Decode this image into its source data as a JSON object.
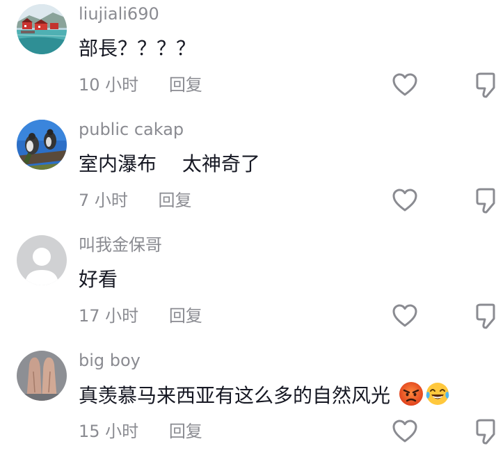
{
  "comments": [
    {
      "username": "liujiali690",
      "text": "部長？？？？",
      "time": "10 小时",
      "reply_label": "回复",
      "avatar": "harbor-houses-avatar"
    },
    {
      "username": "public cakap",
      "text": "室内瀑布　 太神奇了",
      "time": "7 小时",
      "reply_label": "回复",
      "avatar": "birds-avatar"
    },
    {
      "username": "叫我金保哥",
      "text": "好看",
      "time": "17 小时",
      "reply_label": "回复",
      "avatar": "default-avatar"
    },
    {
      "username": "big boy",
      "text": "真羡慕马来西亚有这么多的自然风光",
      "time": "15 小时",
      "reply_label": "回复",
      "avatar": "hands-avatar",
      "emojis": [
        "angry-face-emoji",
        "tears-of-joy-emoji"
      ]
    }
  ],
  "icons": {
    "like": "heart-outline-icon",
    "dislike": "thumbs-down-outline-icon"
  },
  "colors": {
    "username": "#8a8b91",
    "text": "#161823",
    "meta": "#8a8b91",
    "icon": "#8a8b91"
  }
}
